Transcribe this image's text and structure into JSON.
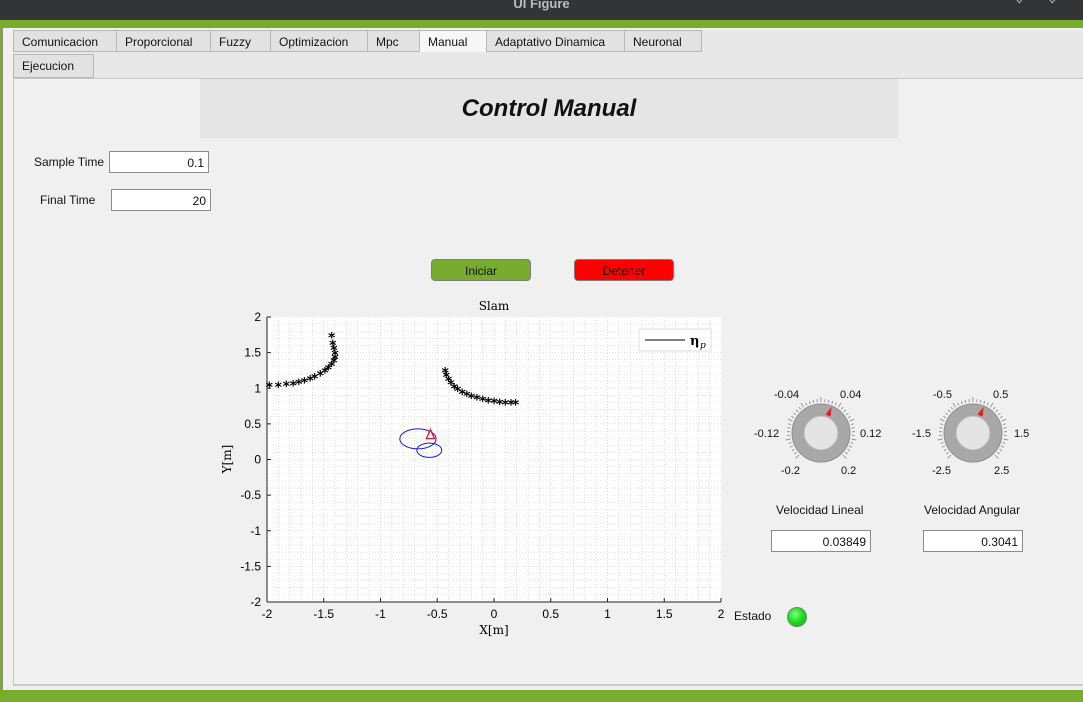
{
  "window": {
    "title": "UI Figure"
  },
  "tabs": [
    {
      "label": "Comunicacion",
      "active": false
    },
    {
      "label": "Proporcional",
      "active": false
    },
    {
      "label": "Fuzzy",
      "active": false
    },
    {
      "label": "Optimizacion",
      "active": false
    },
    {
      "label": "Mpc",
      "active": false
    },
    {
      "label": "Manual",
      "active": true
    },
    {
      "label": "Adaptativo Dinamica",
      "active": false
    },
    {
      "label": "Neuronal",
      "active": false
    },
    {
      "label": "Ejecucion",
      "active": false
    }
  ],
  "panel_title": "Control Manual",
  "sample_time": {
    "label": "Sample Time",
    "value": "0.1"
  },
  "final_time": {
    "label": "Final Time",
    "value": "20"
  },
  "buttons": {
    "start": {
      "label": "Iniciar",
      "color": "#77ac2f"
    },
    "stop": {
      "label": "Detener",
      "color": "#ff0000"
    }
  },
  "knob_lineal": {
    "labels": [
      "-0.04",
      "0.04",
      "-0.12",
      "0.12",
      "-0.2",
      "0.2"
    ],
    "caption": "Velocidad Lineal",
    "value": "0.03849"
  },
  "knob_angular": {
    "labels": [
      "-0.5",
      "0.5",
      "-1.5",
      "1.5",
      "-2.5",
      "2.5"
    ],
    "caption": "Velocidad Angular",
    "value": "0.3041"
  },
  "estado": {
    "label": "Estado",
    "color": "#22dd22"
  },
  "chart_data": {
    "type": "scatter",
    "title": "Slam",
    "xlabel": "X[m]",
    "ylabel": "Y[m]",
    "xlim": [
      -2,
      2
    ],
    "ylim": [
      -2,
      2
    ],
    "xticks": [
      "-2",
      "-1.5",
      "-1",
      "-0.5",
      "0",
      "0.5",
      "1",
      "1.5",
      "2"
    ],
    "yticks": [
      "2",
      "1.5",
      "1",
      "0.5",
      "0",
      "-0.5",
      "-1",
      "-1.5",
      "-2"
    ],
    "grid": true,
    "legend": {
      "label": "η",
      "subscript": "p",
      "position": "top-right"
    },
    "series": [
      {
        "marker": "*",
        "x": [
          -1.98,
          -1.9,
          -1.83,
          -1.77,
          -1.72,
          -1.67,
          -1.62,
          -1.58,
          -1.53,
          -1.49,
          -1.46,
          -1.43,
          -1.41,
          -1.4,
          -1.4,
          -1.41,
          -1.42,
          -1.43
        ],
        "y": [
          1.02,
          1.02,
          1.03,
          1.04,
          1.06,
          1.08,
          1.11,
          1.14,
          1.18,
          1.22,
          1.26,
          1.31,
          1.36,
          1.41,
          1.47,
          1.54,
          1.61,
          1.71
        ]
      },
      {
        "marker": "*",
        "x": [
          -0.43,
          -0.42,
          -0.4,
          -0.38,
          -0.35,
          -0.32,
          -0.28,
          -0.24,
          -0.2,
          -0.15,
          -0.1,
          -0.05,
          0.0,
          0.05,
          0.1,
          0.15,
          0.19
        ],
        "y": [
          1.22,
          1.16,
          1.1,
          1.05,
          1.0,
          0.96,
          0.92,
          0.89,
          0.86,
          0.84,
          0.82,
          0.8,
          0.79,
          0.78,
          0.77,
          0.77,
          0.77
        ]
      }
    ],
    "ellipses": [
      {
        "cx": -0.67,
        "cy": 0.29,
        "rx": 0.16,
        "ry": 0.14,
        "color": "#1a1adb"
      },
      {
        "cx": -0.57,
        "cy": 0.13,
        "rx": 0.11,
        "ry": 0.1,
        "color": "#1a1adb"
      }
    ],
    "robot": {
      "x": -0.56,
      "y": 0.35,
      "color": "#e0202a"
    }
  }
}
